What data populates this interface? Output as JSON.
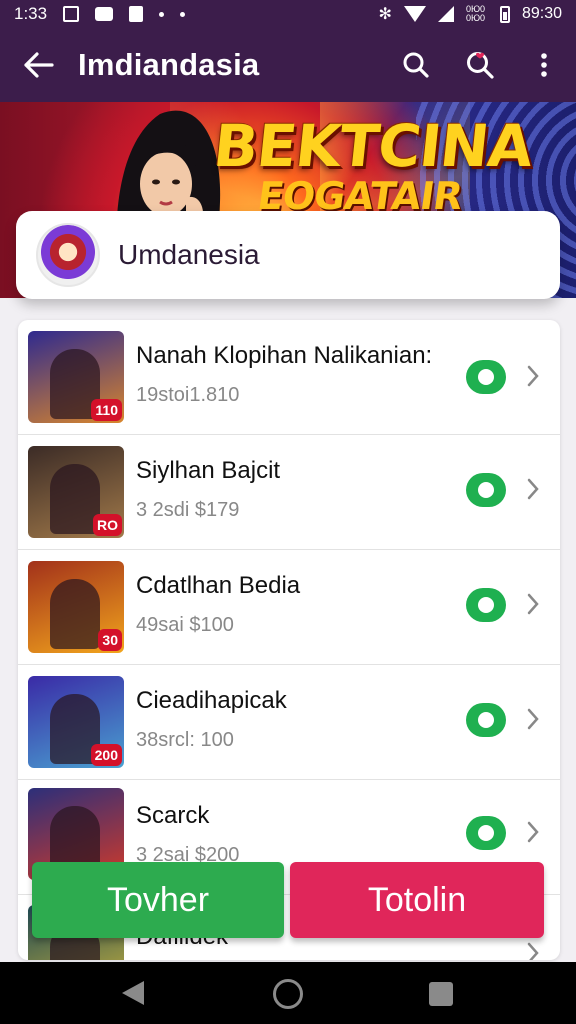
{
  "status_bar": {
    "time": "1:33",
    "clock_right": "89:30",
    "small_text": "0Ю0 0Ю0"
  },
  "app_bar": {
    "title": "Imdiandasia"
  },
  "banner": {
    "title": "BEKTCINA",
    "subtitle": "EOGATAIR"
  },
  "channel": {
    "name": "Umdanesia"
  },
  "list": [
    {
      "title": "Nanah Klopihan Nalikanian:",
      "subtitle": "19stoi1.810",
      "badge": "110",
      "colors": [
        "#2f2a8f",
        "#d9862c"
      ]
    },
    {
      "title": "Siylhan Bajcit",
      "subtitle": "3 2sdi $179",
      "badge": "RO",
      "colors": [
        "#3b2b26",
        "#a27a4a"
      ]
    },
    {
      "title": "Cdatlhan Bedia",
      "subtitle": "49sai $100",
      "badge": "30",
      "colors": [
        "#a2311b",
        "#f2a51c"
      ]
    },
    {
      "title": "Cieadihapicak",
      "subtitle": "38srcl: 100",
      "badge": "200",
      "colors": [
        "#3a2aa6",
        "#4aa1d1"
      ]
    },
    {
      "title": "Scarck",
      "subtitle": "3 2sai $200",
      "badge": "",
      "colors": [
        "#2c2f7a",
        "#d03a2a"
      ]
    },
    {
      "title": "Dafiildek",
      "subtitle": "",
      "badge": "",
      "colors": [
        "#1e4a55",
        "#c9b23c"
      ]
    }
  ],
  "buttons": {
    "green_label": "Tovher",
    "red_label": "Totolin"
  },
  "icons": [
    "arrow-back-icon",
    "search-icon",
    "search-heart-icon",
    "more-vert-icon",
    "chevron-right-icon"
  ],
  "colors": {
    "app_bar": "#3c1d4b",
    "green": "#2dab4f",
    "red": "#e0265a",
    "toggle": "#1fb050"
  }
}
